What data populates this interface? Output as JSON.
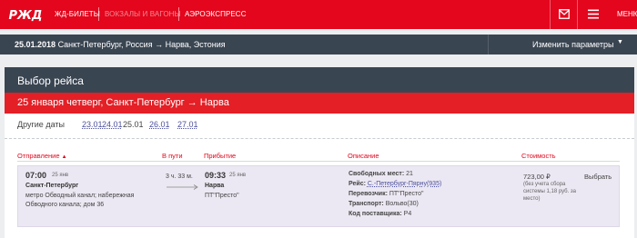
{
  "nav": {
    "items": [
      {
        "label": "ЖД-БИЛЕТЫ"
      },
      {
        "label": "ВОКЗАЛЫ И ВАГОНЫ"
      },
      {
        "label": "АЭРОЭКСПРЕСС"
      }
    ],
    "menu_label": "МЕНЮ"
  },
  "route_bar": {
    "date": "25.01.2018",
    "route": "Санкт-Петербург, Россия → Нарва, Эстония",
    "change_label": "Изменить параметры"
  },
  "card": {
    "title": "Выбор рейса",
    "date_banner": "25 января четверг, Санкт-Петербург → Нарва",
    "other_dates_label": "Другие даты",
    "dates": [
      "23.01",
      "24.01",
      "25.01",
      "26.01",
      "27.01"
    ],
    "current_date": "25.01"
  },
  "table": {
    "headers": {
      "departure": "Отправление",
      "duration": "В пути",
      "arrival": "Прибытие",
      "description": "Описание",
      "price": "Стоимость"
    },
    "row": {
      "dep_time": "07:00",
      "dep_date": "25 янв",
      "dep_city": "Санкт-Петербург",
      "dep_station_1": "метро Обводный канал; набережная",
      "dep_station_2": "Обводного канала; дом 36",
      "duration": "3 ч. 33 м.",
      "arr_time": "09:33",
      "arr_date": "25 янв",
      "arr_city": "Нарва",
      "arr_station": "ПТ\"Престо\"",
      "seats_label": "Свободных мест:",
      "seats_value": "21",
      "trip_label": "Рейс:",
      "trip_value": "С.-Петербург-Пярну(935)",
      "carrier_label": "Перевозчик:",
      "carrier_value": "ПТ\"Престо\"",
      "transport_label": "Транспорт:",
      "transport_value": "Вольво(30)",
      "supplier_label": "Код поставщика:",
      "supplier_value": "P4",
      "price": "723,00 ₽",
      "price_note_1": "(без учета сбора",
      "price_note_2": "системы 1,18 руб. за",
      "price_note_3": "место)",
      "select_label": "Выбрать"
    }
  }
}
